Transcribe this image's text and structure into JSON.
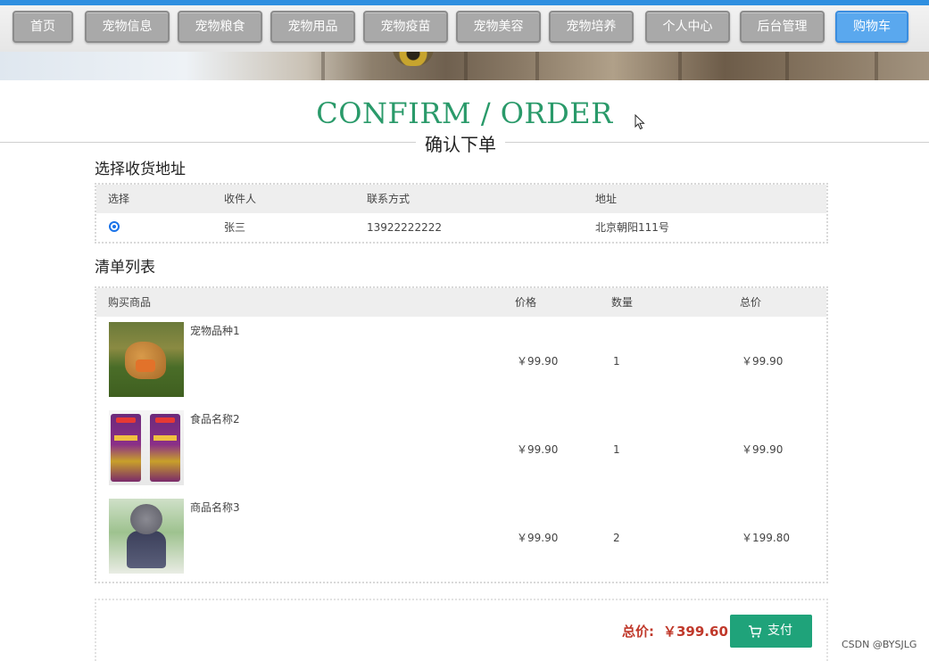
{
  "nav": {
    "items": [
      "首页",
      "宠物信息",
      "宠物粮食",
      "宠物用品",
      "宠物疫苗",
      "宠物美容",
      "宠物培养",
      "个人中心",
      "后台管理",
      "购物车"
    ],
    "active_index": 9
  },
  "header": {
    "title_en": "CONFIRM / ORDER",
    "title_cn": "确认下单"
  },
  "address": {
    "section_title": "选择收货地址",
    "columns": [
      "选择",
      "收件人",
      "联系方式",
      "地址"
    ],
    "rows": [
      {
        "selected": true,
        "recipient": "张三",
        "phone": "13922222222",
        "address": "北京朝阳111号"
      }
    ]
  },
  "items": {
    "section_title": "清单列表",
    "columns": [
      "购买商品",
      "价格",
      "数量",
      "总价"
    ],
    "rows": [
      {
        "name": "宠物品种1",
        "price": "￥99.90",
        "qty": "1",
        "total": "￥99.90",
        "image": "dog-photo"
      },
      {
        "name": "食品名称2",
        "price": "￥99.90",
        "qty": "1",
        "total": "￥99.90",
        "image": "pet-food-bags"
      },
      {
        "name": "商品名称3",
        "price": "￥99.90",
        "qty": "2",
        "total": "￥199.80",
        "image": "poodle-photo"
      }
    ]
  },
  "summary": {
    "total_label": "总价:",
    "total_value": "￥399.60",
    "pay_label": "支付"
  },
  "watermark": "CSDN @BYSJLG",
  "colors": {
    "accent_green": "#1fa37a",
    "title_green": "#2a9a6a",
    "total_red": "#c0392b",
    "nav_active": "#5aa8ee",
    "nav_inactive": "#a9a9a9"
  }
}
